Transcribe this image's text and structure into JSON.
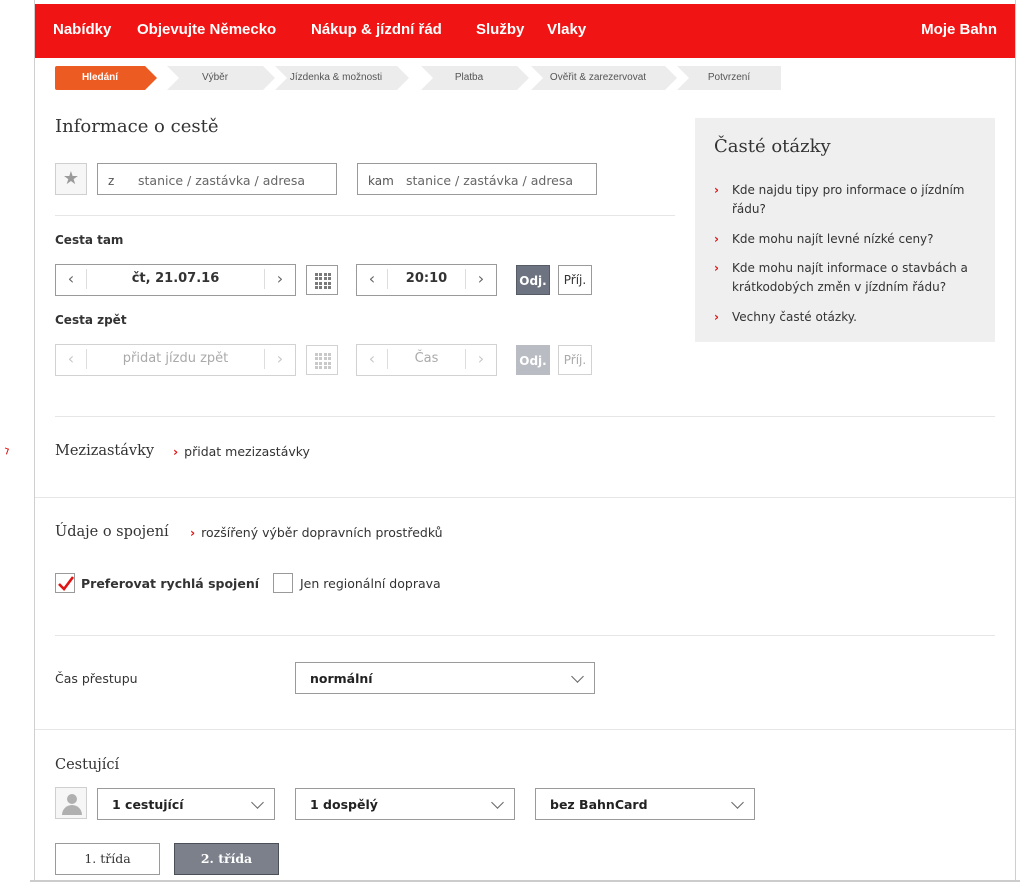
{
  "nav": {
    "items": [
      "Nabídky",
      "Objevujte Německo",
      "Nákup & jízdní řád",
      "Služby",
      "Vlaky"
    ],
    "account": "Moje Bahn"
  },
  "steps": [
    "Hledání",
    "Výběr",
    "Jízdenka & možnosti",
    "Platba",
    "Ověřit & zarezervovat",
    "Potvrzení"
  ],
  "trip": {
    "title": "Informace o cestě",
    "from_prefix": "z",
    "from_placeholder": "stanice / zastávka / adresa",
    "to_prefix": "kam",
    "to_placeholder": "stanice / zastávka / adresa",
    "outbound_label": "Cesta tam",
    "outbound_date": "čt, 21.07.16",
    "outbound_time": "20:10",
    "depart_label": "Odj.",
    "arrive_label": "Příj.",
    "return_label": "Cesta zpět",
    "return_date_placeholder": "přidat jízdu zpět",
    "return_time_placeholder": "Čas"
  },
  "stops": {
    "title": "Mezizastávky",
    "link": "přidat mezizastávky"
  },
  "connection": {
    "title": "Údaje o spojení",
    "link": "rozšířený výběr dopravních prostředků",
    "fast_label": "Preferovat rychlá spojení",
    "fast_checked": true,
    "regional_label": "Jen regionální doprava",
    "regional_checked": false
  },
  "transfer": {
    "label": "Čas přestupu",
    "value": "normální"
  },
  "travellers": {
    "title": "Cestující",
    "count": "1 cestující",
    "type": "1 dospělý",
    "card": "bez BahnCard",
    "class_first": "1. třída",
    "class_second": "2. třída",
    "selected_class": "2. třída"
  },
  "faq": {
    "title": "Časté otázky",
    "items": [
      "Kde najdu tipy pro informace o jízdním řádu?",
      "Kde mohu najít levné nízké ceny?",
      "Kde mohu najít informace o stavbách a krátkodobých změn v jízdním řádu?",
      "Vechny časté otázky."
    ]
  },
  "colors": {
    "brand_red": "#f01414",
    "step_active": "#ec5b22",
    "button_dark": "#6d7380"
  },
  "icons": {
    "favorite": "star-icon",
    "calendar": "calendar-grid-icon",
    "traveller": "person-icon",
    "link": "chevron-right-icon",
    "dropdown": "chevron-down-icon",
    "check": "checkmark-icon"
  }
}
